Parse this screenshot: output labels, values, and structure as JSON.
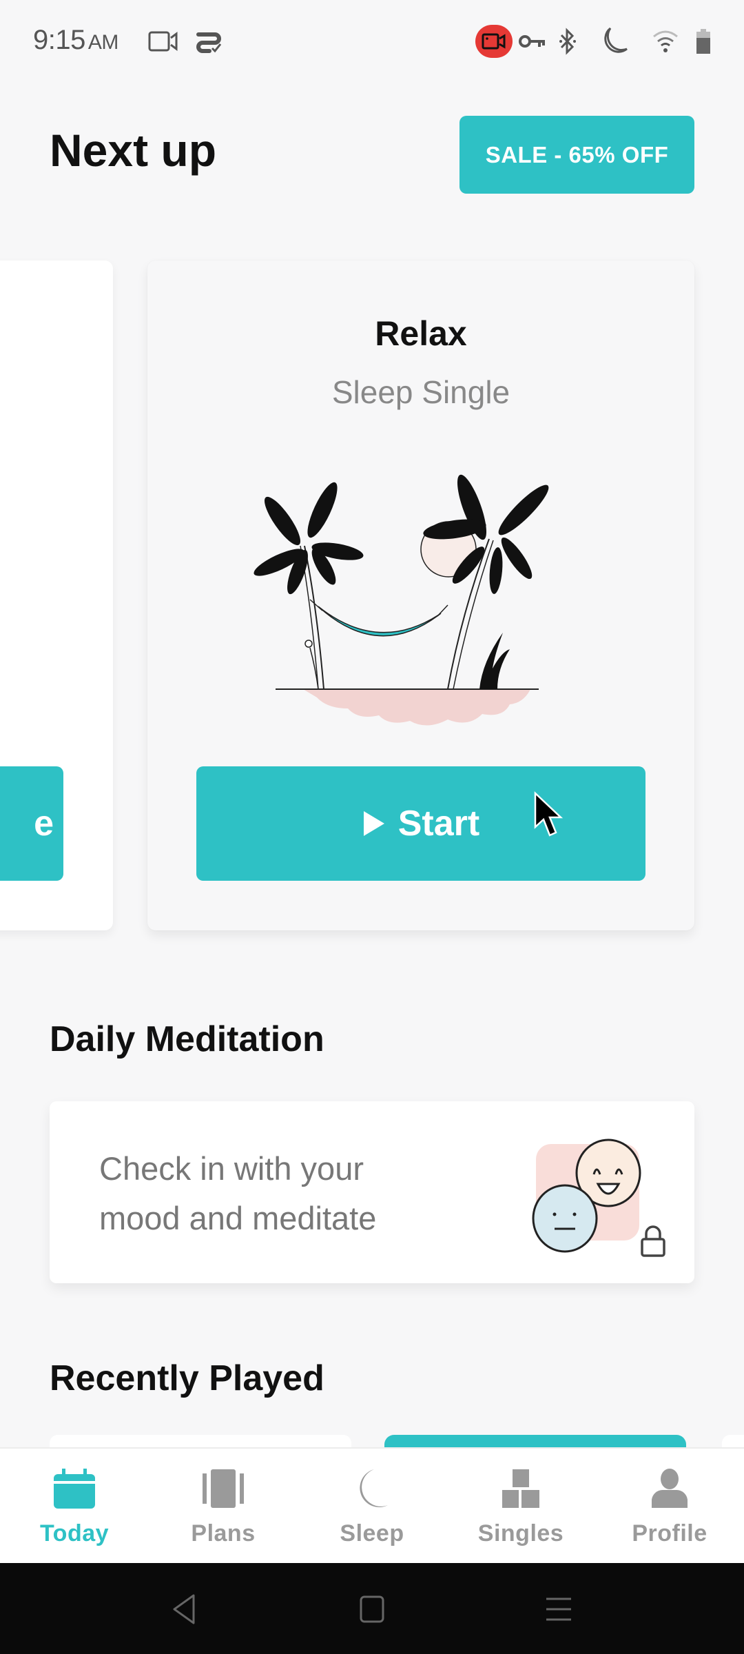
{
  "status_bar": {
    "time": "9:15",
    "ampm": "AM",
    "left_icons": [
      "video-camera-icon",
      "sync-check-icon"
    ],
    "right_icons": [
      "screen-record-icon",
      "vpn-key-icon",
      "bluetooth-icon",
      "do-not-disturb-moon-icon",
      "wifi-icon",
      "battery-icon"
    ]
  },
  "header": {
    "title": "Next up",
    "sale_button": "SALE - 65% OFF"
  },
  "carousel": {
    "previous_card": {
      "button_partial_label": "e"
    },
    "current_card": {
      "title": "Relax",
      "subtitle": "Sleep Single",
      "illustration": "palm-trees-hammock-illustration",
      "start_button": "Start"
    }
  },
  "daily_meditation": {
    "section_title": "Daily Meditation",
    "card_text": "Check in with your mood and meditate",
    "locked": true
  },
  "recently_played": {
    "section_title": "Recently Played"
  },
  "bottom_nav": {
    "items": [
      {
        "label": "Today",
        "icon": "calendar-icon",
        "active": true
      },
      {
        "label": "Plans",
        "icon": "plans-icon",
        "active": false
      },
      {
        "label": "Sleep",
        "icon": "moon-icon",
        "active": false
      },
      {
        "label": "Singles",
        "icon": "blocks-icon",
        "active": false
      },
      {
        "label": "Profile",
        "icon": "person-icon",
        "active": false
      }
    ]
  },
  "colors": {
    "accent": "#2ec1c5",
    "background": "#f7f7f8",
    "inactive_nav": "#9a9a9a"
  }
}
